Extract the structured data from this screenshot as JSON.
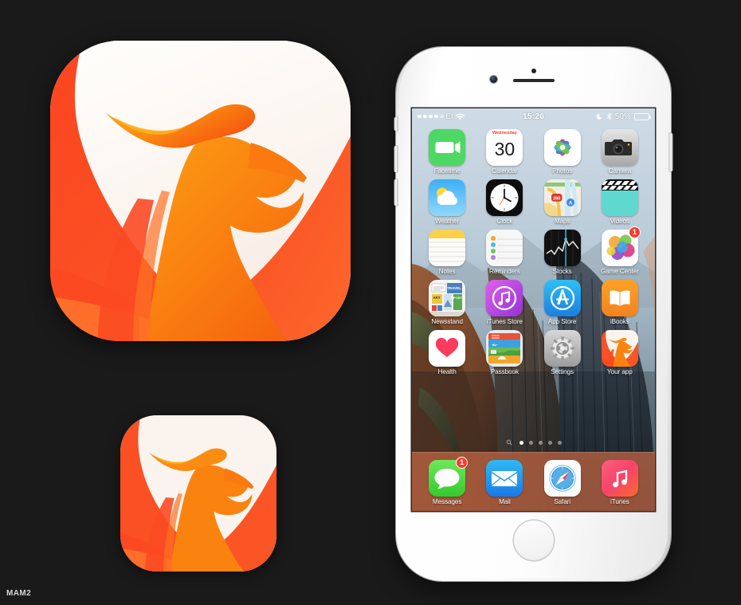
{
  "canvas": {
    "background_color": "#1a1a1a",
    "watermark": "MAM2"
  },
  "brand_icon": {
    "name": "phoenix-app-icon",
    "colors": {
      "red_orange": "#fb4a22",
      "orange": "#fa8c13",
      "deep_orange": "#f26a12",
      "cream": "#faf5f0",
      "white": "#ffffff"
    },
    "large_label": "",
    "small_label": ""
  },
  "phone": {
    "model_color": "silver-white",
    "hardware": {
      "mute_switch": "mute-switch",
      "volume_up": "volume-up-button",
      "volume_down": "volume-down-button",
      "power": "power-button",
      "home": "home-button",
      "earpiece": "earpiece-speaker",
      "front_camera": "front-camera",
      "proximity": "proximity-sensor"
    }
  },
  "status_bar": {
    "signal_dots": [
      true,
      true,
      true,
      true,
      false
    ],
    "carrier": "EI",
    "wifi_icon": "wifi-icon",
    "time": "15:26",
    "moon_icon": "do-not-disturb-icon",
    "bluetooth_icon": "bluetooth-icon",
    "battery_percent": "50%",
    "battery_level": 50
  },
  "home_screen": {
    "rows": [
      [
        {
          "label": "Facetime",
          "icon": "facetime-icon"
        },
        {
          "label": "Calendar",
          "icon": "calendar-icon",
          "weekday": "Wednesday",
          "day": "30"
        },
        {
          "label": "Photos",
          "icon": "photos-icon"
        },
        {
          "label": "Camera",
          "icon": "camera-icon"
        }
      ],
      [
        {
          "label": "Weather",
          "icon": "weather-icon"
        },
        {
          "label": "Clock",
          "icon": "clock-icon"
        },
        {
          "label": "Maps",
          "icon": "maps-icon",
          "route": "280"
        },
        {
          "label": "Videos",
          "icon": "videos-icon"
        }
      ],
      [
        {
          "label": "Notes",
          "icon": "notes-icon"
        },
        {
          "label": "Reminders",
          "icon": "reminders-icon"
        },
        {
          "label": "Stocks",
          "icon": "stocks-icon"
        },
        {
          "label": "Game Center",
          "icon": "game-center-icon",
          "badge": "1"
        }
      ],
      [
        {
          "label": "Newsstand",
          "icon": "newsstand-icon"
        },
        {
          "label": "iTunes Store",
          "icon": "itunes-store-icon"
        },
        {
          "label": "App Store",
          "icon": "app-store-icon"
        },
        {
          "label": "iBooks",
          "icon": "ibooks-icon"
        }
      ],
      [
        {
          "label": "Health",
          "icon": "health-icon"
        },
        {
          "label": "Passbook",
          "icon": "passbook-icon"
        },
        {
          "label": "Settings",
          "icon": "settings-icon"
        },
        {
          "label": "Your app",
          "icon": "phoenix-app-icon"
        }
      ]
    ],
    "page_indicator": {
      "search_icon": "search-icon",
      "total_pages": 5,
      "active_page": 1
    },
    "dock": [
      {
        "label": "Messages",
        "icon": "messages-icon",
        "badge": "1"
      },
      {
        "label": "Mail",
        "icon": "mail-icon"
      },
      {
        "label": "Safari",
        "icon": "safari-icon"
      },
      {
        "label": "iTunes",
        "icon": "itunes-icon"
      }
    ]
  }
}
